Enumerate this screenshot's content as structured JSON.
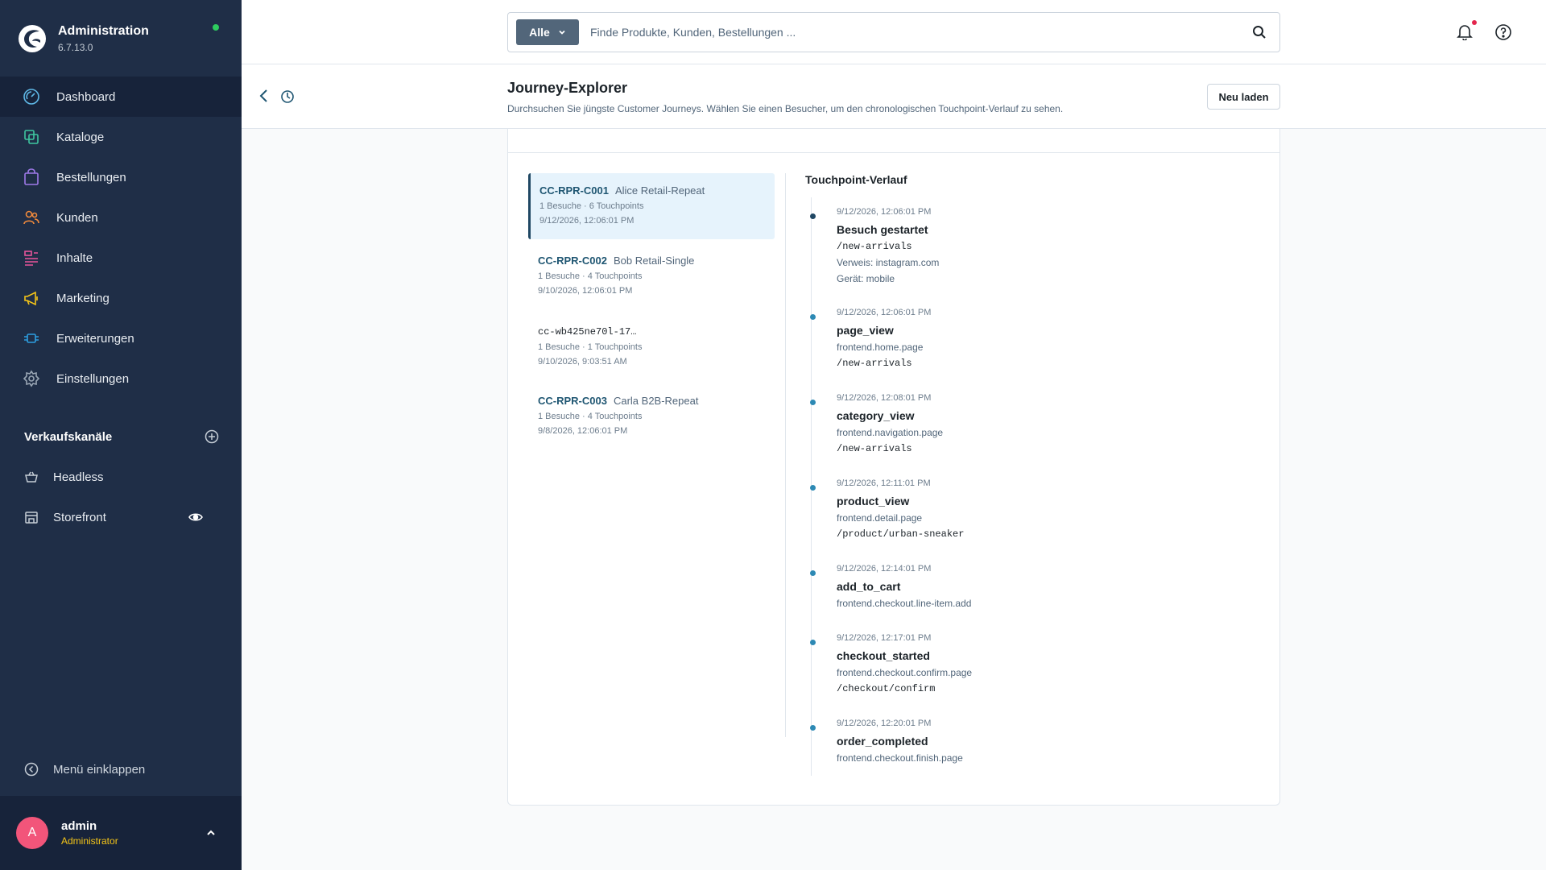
{
  "brand": {
    "title": "Administration",
    "version": "6.7.13.0"
  },
  "nav": [
    {
      "label": "Dashboard",
      "icon": "dashboard-icon",
      "active": true
    },
    {
      "label": "Kataloge",
      "icon": "catalog-icon"
    },
    {
      "label": "Bestellungen",
      "icon": "orders-icon"
    },
    {
      "label": "Kunden",
      "icon": "customers-icon"
    },
    {
      "label": "Inhalte",
      "icon": "content-icon"
    },
    {
      "label": "Marketing",
      "icon": "marketing-icon"
    },
    {
      "label": "Erweiterungen",
      "icon": "extensions-icon"
    },
    {
      "label": "Einstellungen",
      "icon": "settings-icon"
    }
  ],
  "sales_channels": {
    "title": "Verkaufskanäle",
    "items": [
      {
        "label": "Headless"
      },
      {
        "label": "Storefront"
      }
    ]
  },
  "collapse_label": "Menü einklappen",
  "user": {
    "initial": "A",
    "name": "admin",
    "role": "Administrator"
  },
  "search": {
    "type": "Alle",
    "placeholder": "Finde Produkte, Kunden, Bestellungen ..."
  },
  "page": {
    "title": "Journey-Explorer",
    "subtitle": "Durchsuchen Sie jüngste Customer Journeys. Wählen Sie einen Besucher, um den chronologischen Touchpoint-Verlauf zu sehen.",
    "reload_label": "Neu laden"
  },
  "visitors": [
    {
      "id": "CC-RPR-C001",
      "name": "Alice Retail-Repeat",
      "meta": "1 Besuche · 6 Touchpoints",
      "date": "9/12/2026, 12:06:01 PM",
      "active": true
    },
    {
      "id": "CC-RPR-C002",
      "name": "Bob Retail-Single",
      "meta": "1 Besuche · 4 Touchpoints",
      "date": "9/10/2026, 12:06:01 PM"
    },
    {
      "id": "cc-wb425ne70l-17…",
      "name": "",
      "meta": "1 Besuche · 1 Touchpoints",
      "date": "9/10/2026, 9:03:51 AM"
    },
    {
      "id": "CC-RPR-C003",
      "name": "Carla B2B-Repeat",
      "meta": "1 Besuche · 4 Touchpoints",
      "date": "9/8/2026, 12:06:01 PM"
    }
  ],
  "timeline": {
    "title": "Touchpoint-Verlauf",
    "entries": [
      {
        "time": "9/12/2026, 12:06:01 PM",
        "name": "Besuch gestartet",
        "path": "/new-arrivals",
        "lines": [
          "Verweis: instagram.com",
          "Gerät: mobile"
        ]
      },
      {
        "time": "9/12/2026, 12:06:01 PM",
        "name": "page_view",
        "route": "frontend.home.page",
        "path": "/new-arrivals"
      },
      {
        "time": "9/12/2026, 12:08:01 PM",
        "name": "category_view",
        "route": "frontend.navigation.page",
        "path": "/new-arrivals"
      },
      {
        "time": "9/12/2026, 12:11:01 PM",
        "name": "product_view",
        "route": "frontend.detail.page",
        "path": "/product/urban-sneaker"
      },
      {
        "time": "9/12/2026, 12:14:01 PM",
        "name": "add_to_cart",
        "route": "frontend.checkout.line-item.add"
      },
      {
        "time": "9/12/2026, 12:17:01 PM",
        "name": "checkout_started",
        "route": "frontend.checkout.confirm.page",
        "path": "/checkout/confirm"
      },
      {
        "time": "9/12/2026, 12:20:01 PM",
        "name": "order_completed",
        "route": "frontend.checkout.finish.page"
      }
    ]
  }
}
